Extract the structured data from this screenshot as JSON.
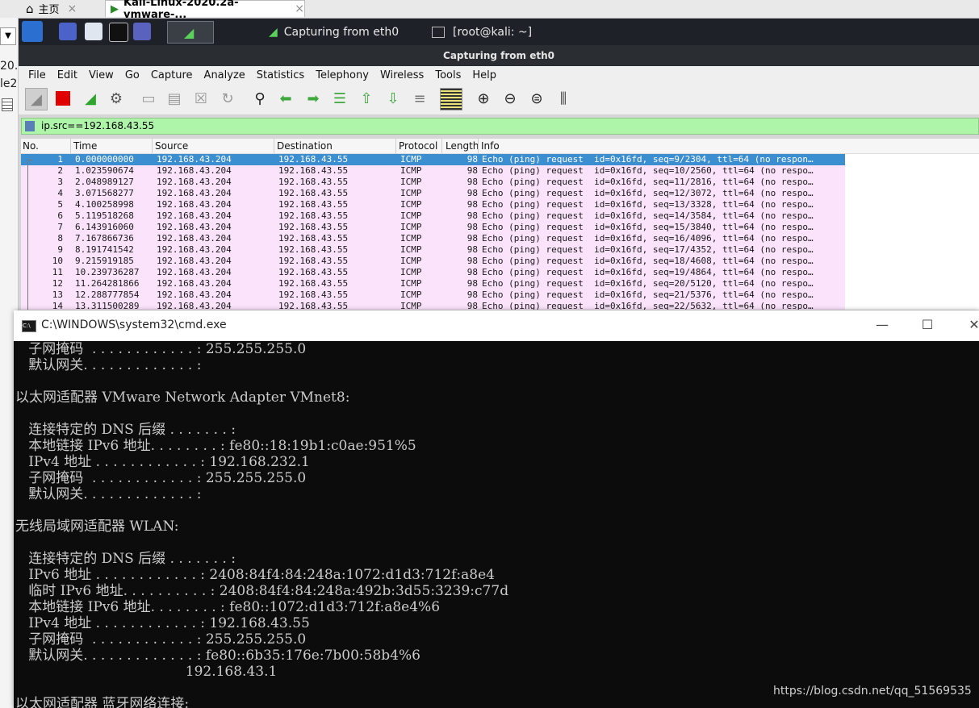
{
  "host_tabs": {
    "home_label": "主页",
    "vm_tab_label": "Kali-Linux-2020.2a-vmware-...",
    "close_glyph": "×"
  },
  "left_gutter": {
    "line1": "20.",
    "line2": "le2"
  },
  "kali_taskbar": {
    "task1_label": "Capturing from eth0",
    "task2_label": "[root@kali: ~]"
  },
  "window_title": "Capturing from eth0",
  "menu": [
    "File",
    "Edit",
    "View",
    "Go",
    "Capture",
    "Analyze",
    "Statistics",
    "Telephony",
    "Wireless",
    "Tools",
    "Help"
  ],
  "filter": {
    "value": "ip.src==192.168.43.55"
  },
  "packet_columns": [
    "No.",
    "Time",
    "Source",
    "Destination",
    "Protocol",
    "Length",
    "Info"
  ],
  "packets": [
    {
      "no": "1",
      "time": "0.000000000",
      "src": "192.168.43.204",
      "dst": "192.168.43.55",
      "proto": "ICMP",
      "len": "98",
      "info": "Echo (ping) request  id=0x16fd, seq=9/2304, ttl=64 (no respon…"
    },
    {
      "no": "2",
      "time": "1.023590674",
      "src": "192.168.43.204",
      "dst": "192.168.43.55",
      "proto": "ICMP",
      "len": "98",
      "info": "Echo (ping) request  id=0x16fd, seq=10/2560, ttl=64 (no respo…"
    },
    {
      "no": "3",
      "time": "2.048989127",
      "src": "192.168.43.204",
      "dst": "192.168.43.55",
      "proto": "ICMP",
      "len": "98",
      "info": "Echo (ping) request  id=0x16fd, seq=11/2816, ttl=64 (no respo…"
    },
    {
      "no": "4",
      "time": "3.071568277",
      "src": "192.168.43.204",
      "dst": "192.168.43.55",
      "proto": "ICMP",
      "len": "98",
      "info": "Echo (ping) request  id=0x16fd, seq=12/3072, ttl=64 (no respo…"
    },
    {
      "no": "5",
      "time": "4.100258998",
      "src": "192.168.43.204",
      "dst": "192.168.43.55",
      "proto": "ICMP",
      "len": "98",
      "info": "Echo (ping) request  id=0x16fd, seq=13/3328, ttl=64 (no respo…"
    },
    {
      "no": "6",
      "time": "5.119518268",
      "src": "192.168.43.204",
      "dst": "192.168.43.55",
      "proto": "ICMP",
      "len": "98",
      "info": "Echo (ping) request  id=0x16fd, seq=14/3584, ttl=64 (no respo…"
    },
    {
      "no": "7",
      "time": "6.143916060",
      "src": "192.168.43.204",
      "dst": "192.168.43.55",
      "proto": "ICMP",
      "len": "98",
      "info": "Echo (ping) request  id=0x16fd, seq=15/3840, ttl=64 (no respo…"
    },
    {
      "no": "8",
      "time": "7.167866736",
      "src": "192.168.43.204",
      "dst": "192.168.43.55",
      "proto": "ICMP",
      "len": "98",
      "info": "Echo (ping) request  id=0x16fd, seq=16/4096, ttl=64 (no respo…"
    },
    {
      "no": "9",
      "time": "8.191741542",
      "src": "192.168.43.204",
      "dst": "192.168.43.55",
      "proto": "ICMP",
      "len": "98",
      "info": "Echo (ping) request  id=0x16fd, seq=17/4352, ttl=64 (no respo…"
    },
    {
      "no": "10",
      "time": "9.215919185",
      "src": "192.168.43.204",
      "dst": "192.168.43.55",
      "proto": "ICMP",
      "len": "98",
      "info": "Echo (ping) request  id=0x16fd, seq=18/4608, ttl=64 (no respo…"
    },
    {
      "no": "11",
      "time": "10.239736287",
      "src": "192.168.43.204",
      "dst": "192.168.43.55",
      "proto": "ICMP",
      "len": "98",
      "info": "Echo (ping) request  id=0x16fd, seq=19/4864, ttl=64 (no respo…"
    },
    {
      "no": "12",
      "time": "11.264281866",
      "src": "192.168.43.204",
      "dst": "192.168.43.55",
      "proto": "ICMP",
      "len": "98",
      "info": "Echo (ping) request  id=0x16fd, seq=20/5120, ttl=64 (no respo…"
    },
    {
      "no": "13",
      "time": "12.288777854",
      "src": "192.168.43.204",
      "dst": "192.168.43.55",
      "proto": "ICMP",
      "len": "98",
      "info": "Echo (ping) request  id=0x16fd, seq=21/5376, ttl=64 (no respo…"
    },
    {
      "no": "14",
      "time": "13.311500289",
      "src": "192.168.43.204",
      "dst": "192.168.43.55",
      "proto": "ICMP",
      "len": "98",
      "info": "Echo (ping) request  id=0x16fd, seq=22/5632, ttl=64 (no respo…"
    }
  ],
  "cmd": {
    "title": "C:\\WINDOWS\\system32\\cmd.exe",
    "lines": [
      "   子网掩码  . . . . . . . . . . . . : 255.255.255.0",
      "   默认网关. . . . . . . . . . . . . :",
      "",
      "以太网适配器 VMware Network Adapter VMnet8:",
      "",
      "   连接特定的 DNS 后缀 . . . . . . . :",
      "   本地链接 IPv6 地址. . . . . . . . : fe80::18:19b1:c0ae:951%5",
      "   IPv4 地址 . . . . . . . . . . . . : 192.168.232.1",
      "   子网掩码  . . . . . . . . . . . . : 255.255.255.0",
      "   默认网关. . . . . . . . . . . . . :",
      "",
      "无线局域网适配器 WLAN:",
      "",
      "   连接特定的 DNS 后缀 . . . . . . . :",
      "   IPv6 地址 . . . . . . . . . . . . : 2408:84f4:84:248a:1072:d1d3:712f:a8e4",
      "   临时 IPv6 地址. . . . . . . . . . : 2408:84f4:84:248a:492b:3d55:3239:c77d",
      "   本地链接 IPv6 地址. . . . . . . . : fe80::1072:d1d3:712f:a8e4%6",
      "   IPv4 地址 . . . . . . . . . . . . : 192.168.43.55",
      "   子网掩码  . . . . . . . . . . . . : 255.255.255.0",
      "   默认网关. . . . . . . . . . . . . : fe80::6b35:176e:7b00:58b4%6",
      "                                       192.168.43.1",
      "",
      "以太网适配器 蓝牙网络连接:"
    ]
  },
  "watermark": "https://blog.csdn.net/qq_51569535",
  "colors": {
    "filter_ok": "#aff5a9",
    "row_icmp": "#fbe3fb",
    "row_selected": "#3b8ed0",
    "taskbar": "#1e2228",
    "cmd_bg": "#0c0c0c"
  }
}
